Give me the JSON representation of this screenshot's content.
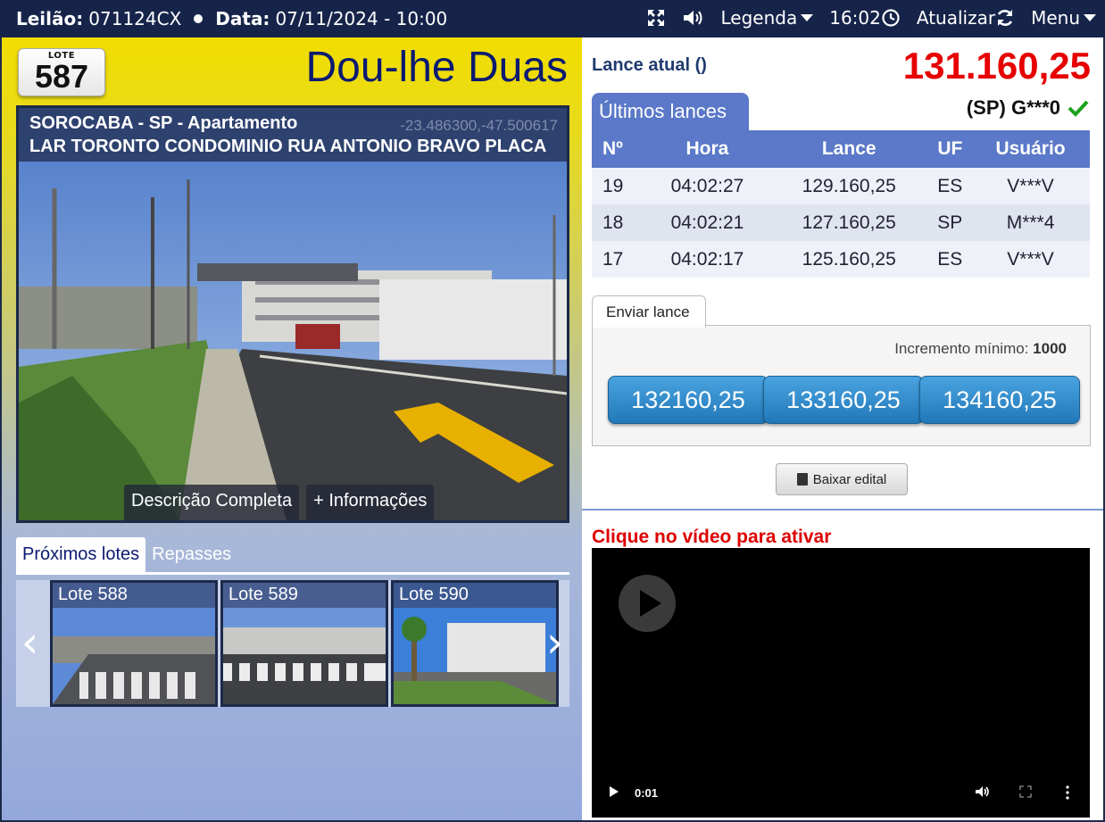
{
  "topbar": {
    "leilao_label": "Leilão:",
    "leilao_value": "071124CX",
    "data_label": "Data:",
    "data_value": "07/11/2024 - 10:00",
    "legenda": "Legenda",
    "time": "16:02",
    "atualizar": "Atualizar",
    "menu": "Menu"
  },
  "lot": {
    "badge_label": "LOTE",
    "number": "587",
    "auction_title": "Dou-lhe Duas",
    "location": "SOROCABA - SP - Apartamento",
    "coords": "-23.486300,-47.500617",
    "address": "LAR TORONTO CONDOMINIO RUA ANTONIO BRAVO PLACA",
    "btn_descricao": "Descrição Completa",
    "btn_info": "+ Informações"
  },
  "next_tabs": [
    "Próximos lotes",
    "Repasses"
  ],
  "carousel": {
    "prev": "‹",
    "next": "›",
    "items": [
      "Lote 588",
      "Lote 589",
      "Lote 590"
    ]
  },
  "bid": {
    "current_label": "Lance atual ()",
    "current_value": "131.160,25",
    "last_tab": "Últimos lances",
    "leader": "(SP) G***0",
    "columns": [
      "Nº",
      "Hora",
      "Lance",
      "UF",
      "Usuário"
    ],
    "rows": [
      {
        "no": "19",
        "hora": "04:02:27",
        "lance": "129.160,25",
        "uf": "ES",
        "user": "V***V"
      },
      {
        "no": "18",
        "hora": "04:02:21",
        "lance": "127.160,25",
        "uf": "SP",
        "user": "M***4"
      },
      {
        "no": "17",
        "hora": "04:02:17",
        "lance": "125.160,25",
        "uf": "ES",
        "user": "V***V"
      }
    ],
    "send_tab": "Enviar lance",
    "inc_label": "Incremento mínimo:",
    "inc_value": "1000",
    "options": [
      "132160,25",
      "133160,25",
      "134160,25"
    ],
    "edital": "Baixar edital"
  },
  "video": {
    "hint": "Clique no vídeo para ativar",
    "time": "0:01"
  },
  "colors": {
    "topbar": "#16244a",
    "accent_blue": "#5b79c8",
    "price_red": "#e60000",
    "title_navy": "#0b1a70"
  }
}
